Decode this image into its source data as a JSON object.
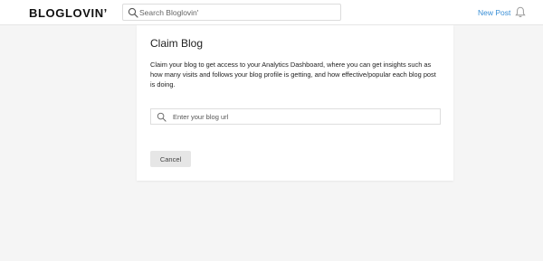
{
  "header": {
    "logo": "BLOGLOVIN’",
    "search": {
      "placeholder": "Search Bloglovin'",
      "value": ""
    },
    "new_post_label": "New Post"
  },
  "claim_blog": {
    "title": "Claim Blog",
    "description": "Claim your blog to get access to your Analytics Dashboard, where you can get insights such as how many visits and follows your blog profile is getting, and how effective/popular each blog post is doing.",
    "url_input": {
      "placeholder": "Enter your blog url",
      "value": ""
    },
    "cancel_label": "Cancel"
  },
  "colors": {
    "accent_link": "#3a8fd6",
    "page_background": "#f5f5f5",
    "card_background": "#ffffff",
    "button_background": "#e6e6e6"
  },
  "icons": {
    "search": "search-icon",
    "notifications": "bell-icon",
    "url_search": "search-icon"
  }
}
